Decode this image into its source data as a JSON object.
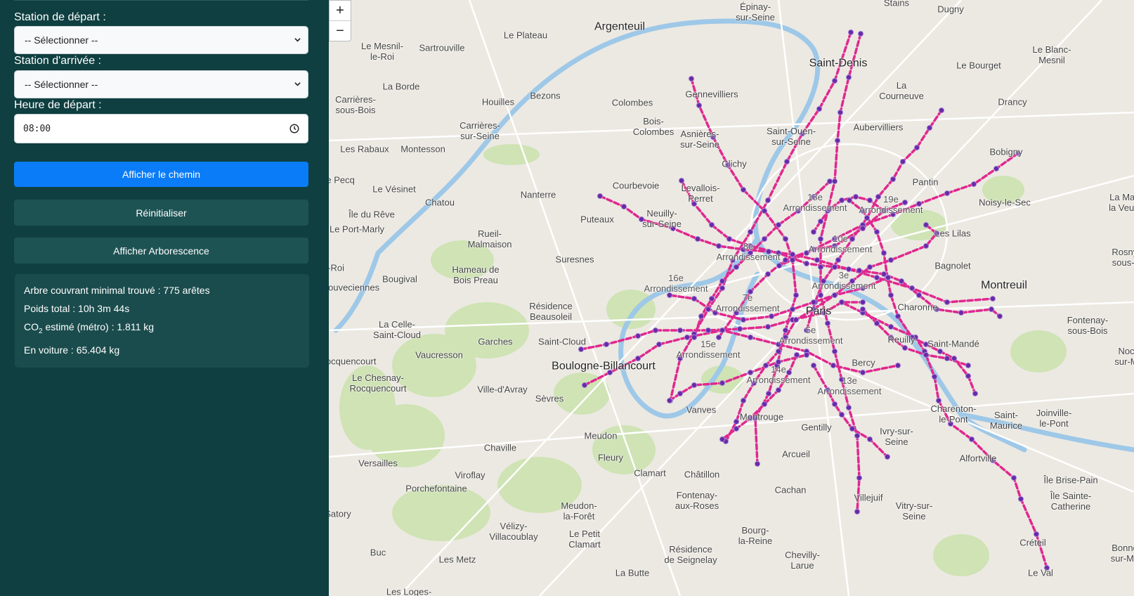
{
  "form": {
    "departure_label": "Station de départ :",
    "departure_value": "-- Sélectionner --",
    "arrival_label": "Station d'arrivée :",
    "arrival_value": "-- Sélectionner --",
    "time_label": "Heure de départ :",
    "time_value": "08:00"
  },
  "buttons": {
    "show_path": "Afficher le chemin",
    "reset": "Réinitialiser",
    "show_tree": "Afficher Arborescence"
  },
  "result": {
    "line1": "Arbre couvrant minimal trouvé : 775 arêtes",
    "line2": "Poids total : 10h 3m 44s",
    "co2_prefix": "CO",
    "co2_sub": "2",
    "co2_rest": " estimé (métro) : 1.811 kg",
    "line4": "En voiture : 65.404 kg"
  },
  "map": {
    "zoom_in": "+",
    "zoom_out": "−",
    "route_color": "#e0288f",
    "station_color": "#6a2aa8",
    "labels": {
      "epinay": "Épinay-\nsur-Seine",
      "stains": "Stains",
      "dugny": "Dugny",
      "argenteuil": "Argenteuil",
      "le_plateau": "Le Plateau",
      "saint_denis": "Saint-Denis",
      "le_bourget": "Le Bourget",
      "le_blanc_mesnil": "Le Blanc-\nMesnil",
      "la_courneuve": "La\nCourneuve",
      "drancy": "Drancy",
      "bobigny": "Bobigny",
      "le_mesnil_le_roi": "Le Mesnil-\nle-Roi",
      "sartrouville": "Sartrouville",
      "la_borde": "La Borde",
      "carrieres_sous_bois": "Carrières-\nsous-Bois",
      "houilles": "Houilles",
      "bezons": "Bezons",
      "colombes": "Colombes",
      "gennevilliers": "Gennevilliers",
      "bois_colombes": "Bois-\nColombes",
      "asnieres": "Asnières-\nsur-Seine",
      "saint_ouen": "Saint-Ouen-\nsur-Seine",
      "aubervilliers": "Aubervilliers",
      "carrieres_sur_seine": "Carrières-\nsur-Seine",
      "les_rabaux": "Les Rabaux",
      "montesson": "Montesson",
      "clichy": "Clichy",
      "pantin": "Pantin",
      "noisy_le_sec": "Noisy-le-Sec",
      "la_mare": "La Mare\nla Veuve",
      "le_pecq": "Le Pecq",
      "le_vesinet": "Le Vésinet",
      "nanterre": "Nanterre",
      "courbevoie": "Courbevoie",
      "levallois": "Levallois-\nPerret",
      "arr18": "18e\nArrondissement",
      "arr19": "19e\nArrondissement",
      "chatou": "Chatou",
      "ile_du_reve": "Île du Rêve",
      "le_port_marly": "Le Port-Marly",
      "puteaux": "Puteaux",
      "neuilly": "Neuilly-\nsur-Seine",
      "les_lilas": "Les Lilas",
      "rosny": "Rosny-\nsous-B",
      "rueil": "Rueil-\nMalmaison",
      "arr8": "8e\nArrondissement",
      "arr10": "10e\nArrondissement",
      "suresnes": "Suresnes",
      "bagnolet": "Bagnolet",
      "le_roi": "le-Roi",
      "louveciennes": "Louveciennes",
      "bougival": "Bougival",
      "hameau": "Hameau de\nBois Preau",
      "arr16": "16e\nArrondissement",
      "arr3": "3e\nArrondissement",
      "montreuil": "Montreuil",
      "residence_beausoleil": "Résidence\nBeausoleil",
      "arr7": "7e\nArrondissement",
      "paris": "Paris",
      "charonne": "Charonne",
      "fontenay_sous_bois": "Fontenay-\nsous-Bois",
      "la_celle": "La Celle-\nSaint-Cloud",
      "garches": "Garches",
      "saint_cloud": "Saint-Cloud",
      "arr5": "5e\nArrondissement",
      "reuilly": "Reuilly",
      "saint_mande": "Saint-Mandé",
      "noc": "Noc\nsur-M",
      "rocquencourt": "Rocquencourt",
      "vaucresson": "Vaucresson",
      "boulogne": "Boulogne-Billancourt",
      "arr15": "15e\nArrondissement",
      "bercy": "Bercy",
      "le_chesnay": "Le Chesnay-\nRocquencourt",
      "ville_davray": "Ville-d'Avray",
      "arr14": "14e\nArrondissement",
      "arr13": "13e\nArrondissement",
      "sevres": "Sèvres",
      "vanves": "Vanves",
      "charenton": "Charenton-\nle-Pont",
      "joinville": "Joinville-\nle-Pont",
      "montrouge": "Montrouge",
      "gentilly": "Gentilly",
      "ivry": "Ivry-sur-\nSeine",
      "saint_maurice": "Saint-\nMaurice",
      "chaville": "Chaville",
      "meudon": "Meudon",
      "versailles": "Versailles",
      "fleury": "Fleury",
      "arcueil": "Arcueil",
      "alfortville": "Alfortville",
      "viroflay": "Viroflay",
      "clamart": "Clamart",
      "porchefontaine": "Porchefontaine",
      "chatillon": "Châtillon",
      "ile_brise_pain": "Île Brise-Pain",
      "meudon_la_foret": "Meudon-\nla-Forêt",
      "cachan": "Cachan",
      "villejuif": "Villejuif",
      "ile_sainte_catherine": "Île Sainte-\nCatherine",
      "fontenay_aux_roses": "Fontenay-\naux-Roses",
      "vitry": "Vitry-sur-\nSeine",
      "satory": "Satory",
      "velizy": "Vélizy-\nVillacoublay",
      "creteil": "Créteil",
      "bourg_la_reine": "Bourg-\nla-Reine",
      "le_petit_clamart": "Le Petit\nClamart",
      "bonne": "Bonne\nsur-Ma",
      "buc": "Buc",
      "residence_seignelay": "Résidence\nde Seignelay",
      "chevilly": "Chevilly-\nLarue",
      "les_metz": "Les Metz",
      "la_butte": "La Butte",
      "le_val": "Le Val",
      "les_loges": "Les Loges-"
    }
  }
}
